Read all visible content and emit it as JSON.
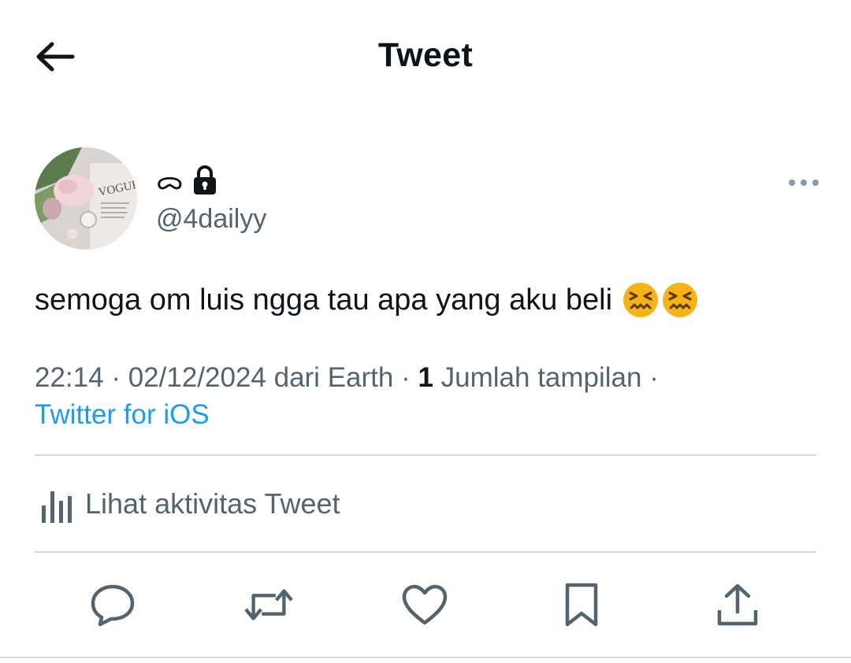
{
  "header": {
    "title": "Tweet",
    "back_icon": "arrow-left-icon"
  },
  "author": {
    "display_name_glyph": "ᯅ",
    "protected_icon": "lock-icon",
    "handle": "@4dailyy",
    "avatar_icon": "avatar-photo"
  },
  "tweet": {
    "text": "semoga om luis ngga tau apa yang aku beli",
    "emoji": [
      "confounded-face-emoji",
      "confounded-face-emoji"
    ]
  },
  "meta": {
    "time": "22:14",
    "sep1": " · ",
    "date": "02/12/2024",
    "location_prefix": " dari ",
    "location": "Earth",
    "sep2": " · ",
    "view_count": "1",
    "view_label": " Jumlah tampilan",
    "sep3": " ·",
    "source": "Twitter for iOS"
  },
  "activity": {
    "label": "Lihat aktivitas Tweet",
    "icon": "bar-chart-icon"
  },
  "actions": [
    {
      "name": "reply",
      "icon": "reply-icon"
    },
    {
      "name": "retweet",
      "icon": "retweet-icon"
    },
    {
      "name": "like",
      "icon": "heart-icon"
    },
    {
      "name": "bookmark",
      "icon": "bookmark-icon"
    },
    {
      "name": "share",
      "icon": "share-icon"
    }
  ],
  "colors": {
    "text": "#0f1419",
    "secondary": "#536471",
    "link": "#1d9bf0",
    "divider": "#cfd9de",
    "emoji": "#f5b316"
  }
}
